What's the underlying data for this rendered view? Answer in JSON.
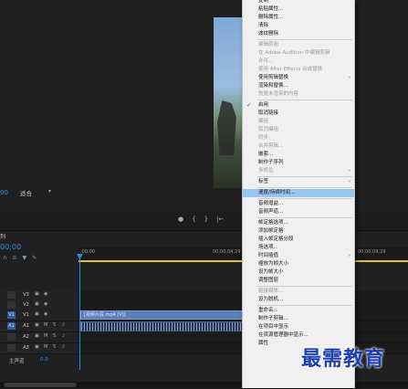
{
  "monitor": {
    "timecode": "00",
    "fit_label": "适合",
    "transport_icons": [
      "marker-icon",
      "in-point-icon",
      "out-point-icon",
      "go-to-in-icon"
    ]
  },
  "timeline": {
    "sequence_tab": "列",
    "timecode": "00;00",
    "ruler_labels": [
      ":00;00",
      "00;00;04;29",
      "00;00;09;29"
    ],
    "tracks": [
      {
        "name": "V3",
        "type": "video"
      },
      {
        "name": "V2",
        "type": "video"
      },
      {
        "name": "V1",
        "type": "video"
      },
      {
        "name": "A1",
        "type": "audio"
      },
      {
        "name": "A2",
        "type": "audio"
      },
      {
        "name": "A3",
        "type": "audio"
      }
    ],
    "video_clip_label": "[视频片段.mp4 [V]]",
    "master_label": "主声道",
    "master_value": "0.0"
  },
  "context_menu": {
    "items": [
      {
        "label": "复制",
        "enabled": true
      },
      {
        "label": "粘贴属性...",
        "enabled": true
      },
      {
        "label": "删除属性...",
        "enabled": true
      },
      {
        "label": "清除",
        "enabled": true
      },
      {
        "label": "波纹删除",
        "enabled": true
      },
      {
        "sep": true
      },
      {
        "label": "编辑原始",
        "enabled": false
      },
      {
        "label": "在 Adobe Audition 中编辑剪辑",
        "enabled": false
      },
      {
        "label": "许可...",
        "enabled": false
      },
      {
        "label": "使用 After Effects 合成替换",
        "enabled": false
      },
      {
        "label": "使用剪辑替换",
        "enabled": true,
        "submenu": true
      },
      {
        "label": "渲染和替换...",
        "enabled": true
      },
      {
        "label": "恢复未渲染的内容",
        "enabled": false
      },
      {
        "sep": true
      },
      {
        "label": "启用",
        "enabled": true,
        "checked": true
      },
      {
        "label": "取消链接",
        "enabled": true
      },
      {
        "label": "编组",
        "enabled": false
      },
      {
        "label": "取消编组",
        "enabled": false
      },
      {
        "label": "同步",
        "enabled": false
      },
      {
        "label": "合并剪辑...",
        "enabled": false
      },
      {
        "label": "嵌套...",
        "enabled": true
      },
      {
        "label": "制作子序列",
        "enabled": true
      },
      {
        "label": "多机位",
        "enabled": false,
        "submenu": true
      },
      {
        "sep": true
      },
      {
        "label": "标签",
        "enabled": true,
        "submenu": true
      },
      {
        "sep": true
      },
      {
        "label": "速度/持续时间...",
        "enabled": true,
        "highlighted": true
      },
      {
        "sep": true
      },
      {
        "label": "音频增益...",
        "enabled": true
      },
      {
        "label": "音频声道...",
        "enabled": true
      },
      {
        "sep": true
      },
      {
        "label": "帧定格选项...",
        "enabled": true
      },
      {
        "label": "添加帧定格",
        "enabled": true
      },
      {
        "label": "插入帧定格分段",
        "enabled": true
      },
      {
        "label": "场选项...",
        "enabled": true
      },
      {
        "label": "时间插值",
        "enabled": true,
        "submenu": true
      },
      {
        "label": "缩放为帧大小",
        "enabled": true
      },
      {
        "label": "设为帧大小",
        "enabled": true
      },
      {
        "label": "调整图层",
        "enabled": true
      },
      {
        "sep": true
      },
      {
        "label": "链接媒体...",
        "enabled": false
      },
      {
        "label": "设为脱机...",
        "enabled": true
      },
      {
        "sep": true
      },
      {
        "label": "重命名...",
        "enabled": true
      },
      {
        "label": "制作子剪辑...",
        "enabled": true
      },
      {
        "label": "在项目中显示",
        "enabled": true
      },
      {
        "label": "在资源管理器中显示...",
        "enabled": true
      },
      {
        "label": "属性",
        "enabled": true
      }
    ]
  },
  "watermark": "最需教育"
}
